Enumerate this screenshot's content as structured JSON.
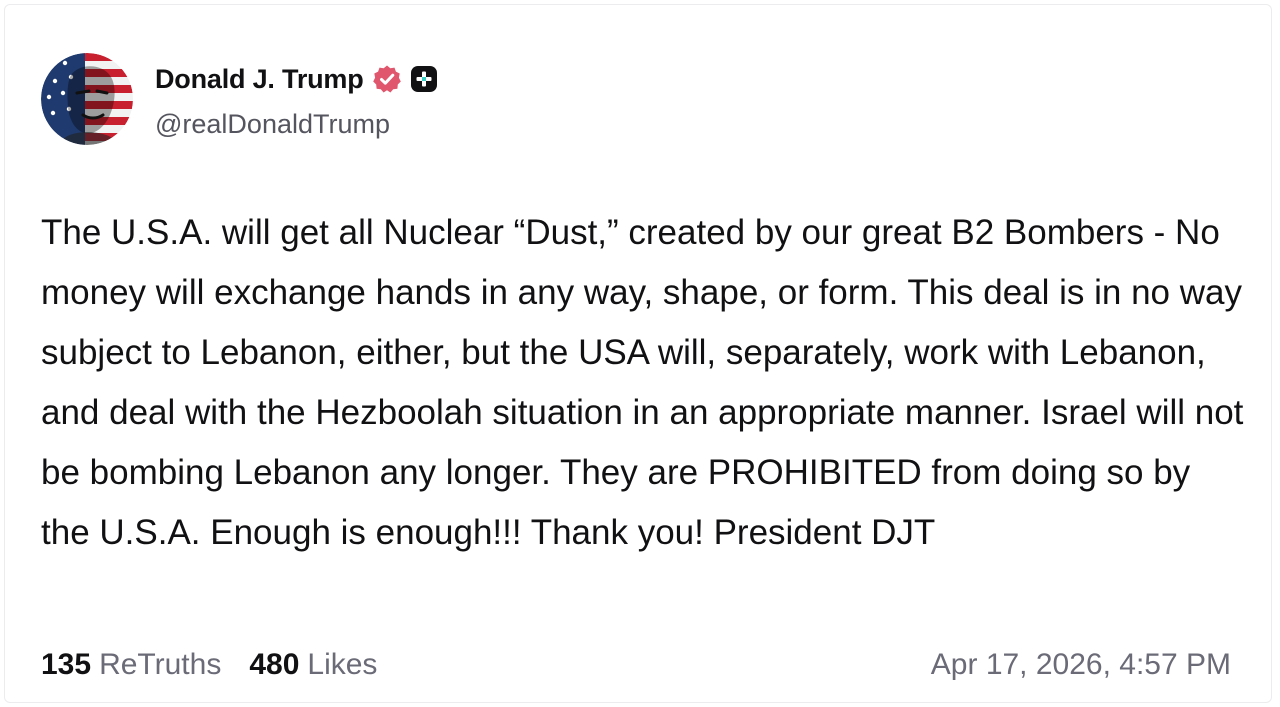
{
  "author": {
    "display_name": "Donald J. Trump",
    "handle": "@realDonaldTrump",
    "verified_icon": "verified-badge-icon",
    "subscription_icon": "truth-plus-icon",
    "avatar_icon": "avatar-american-flag-portrait"
  },
  "post": {
    "text": "The U.S.A. will get all Nuclear “Dust,” created by our great B2 Bombers - No money will exchange hands in any way, shape, or form. This deal is in no way subject to Lebanon, either, but the USA will, separately, work with Lebanon, and deal with the Hezboolah situation in an appropriate manner. Israel will not be bombing Lebanon any longer. They are PROHIBITED from doing so by the U.S.A. Enough is enough!!! Thank you! President DJT"
  },
  "stats": {
    "retruths_count": "135",
    "retruths_label": "ReTruths",
    "likes_count": "480",
    "likes_label": "Likes"
  },
  "timestamp": "Apr 17, 2026, 4:57 PM",
  "colors": {
    "text_primary": "#111113",
    "text_secondary": "#6b6b78",
    "verified_badge": "#e0566c",
    "plus_badge": "#111113"
  }
}
